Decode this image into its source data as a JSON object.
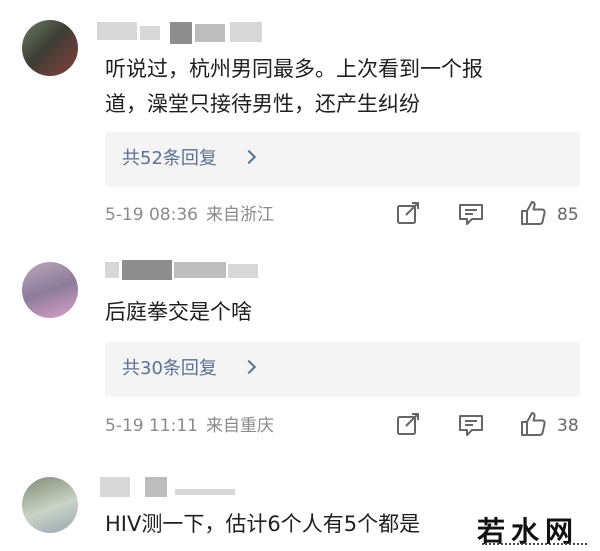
{
  "comments": [
    {
      "text_lines": [
        "听说过，杭州男同最多。上次看到一个报",
        "道，澡堂只接待男性，还产生纠纷"
      ],
      "reply_label": "共52条回复",
      "date": "5-19 08:36",
      "location": "来自浙江",
      "likes": "85"
    },
    {
      "text_lines": [
        "后庭拳交是个啥"
      ],
      "reply_label": "共30条回复",
      "date": "5-19 11:11",
      "location": "来自重庆",
      "likes": "38"
    },
    {
      "text_lines": [
        "HIV测一下，估计6个人有5个都是"
      ]
    }
  ],
  "icons": {
    "share": "share-icon",
    "comment": "comment-icon",
    "like": "thumbs-up-icon"
  },
  "watermark": "若水网",
  "colors": {
    "link": "#5a7193",
    "meta": "#8a8a8a",
    "reply_bg": "#f4f4f4"
  }
}
